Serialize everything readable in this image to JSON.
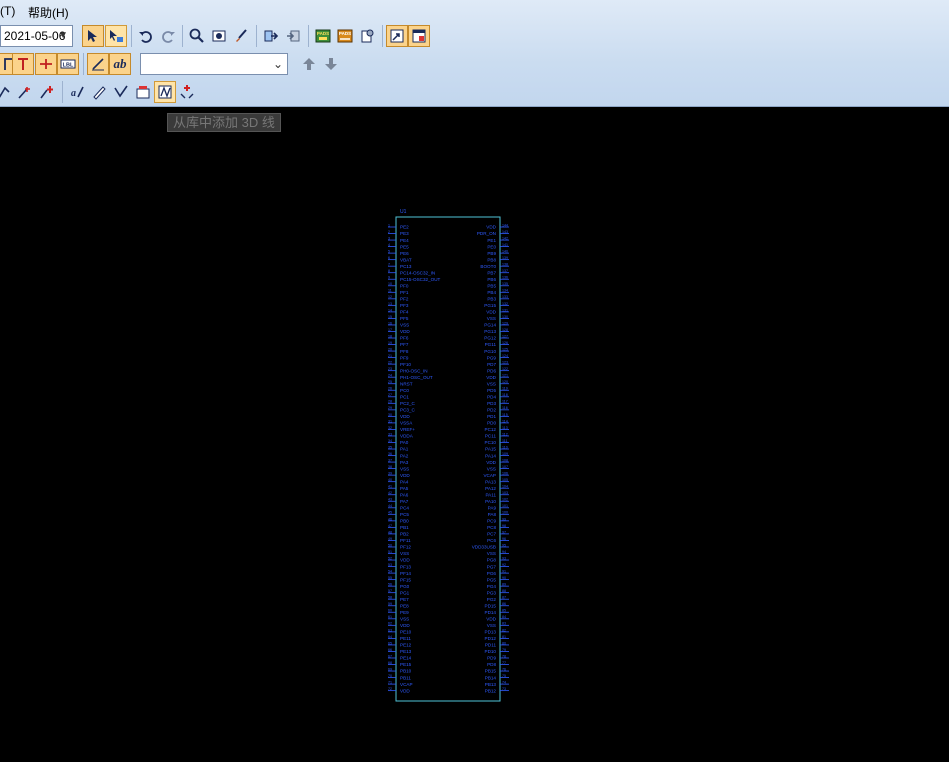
{
  "menu": {
    "partial_label": "(T)",
    "help_label": "帮助(H)"
  },
  "toolbar": {
    "date_value": "2021-05-06",
    "empty_combo_value": "",
    "pads_label_1": "PADS",
    "pads_label_2": "PADS",
    "lbl_text": "LBL",
    "ab_text": "ab"
  },
  "tooltip": {
    "text": "从库中添加 3D 线"
  },
  "schematic": {
    "ref": "U1",
    "colors": {
      "body": "#4fc3d8",
      "text": "#2f5bff",
      "pin": "#2f5bff"
    },
    "left_pins": [
      "PE2",
      "PE3",
      "PE4",
      "PE5",
      "PE6",
      "VBAT",
      "PC13",
      "PC14-OSC32_IN",
      "PC15-OSC32_OUT",
      "PF0",
      "PF1",
      "PF2",
      "PF3",
      "PF4",
      "PF5",
      "VSS",
      "VDD",
      "PF6",
      "PF7",
      "PF8",
      "PF9",
      "PF10",
      "PH0-OSC_IN",
      "PH1-OSC_OUT",
      "NRST",
      "PC0",
      "PC1",
      "PC2_C",
      "PC3_C",
      "VDD",
      "VSSA",
      "VREF+",
      "VDDA",
      "PA0",
      "PA1",
      "PA2",
      "PA3",
      "VSS",
      "VDD",
      "PA4",
      "PA5",
      "PA6",
      "PA7",
      "PC4",
      "PC5",
      "PB0",
      "PB1",
      "PB2",
      "PF11",
      "PF12",
      "VSS",
      "VDD",
      "PF13",
      "PF14",
      "PF15",
      "PG0",
      "PG1",
      "PE7",
      "PE8",
      "PE9",
      "VSS",
      "VDD",
      "PE10",
      "PE11",
      "PE12",
      "PE13",
      "PE14",
      "PE15",
      "PB10",
      "PB11",
      "VCAP",
      "VDD"
    ],
    "right_pins": [
      "VDD",
      "PDR_ON",
      "PE1",
      "PE0",
      "PB9",
      "PB8",
      "BOOT0",
      "PB7",
      "PB6",
      "PB5",
      "PB4",
      "PB3",
      "PG15",
      "VDD",
      "VSS",
      "PG14",
      "PG13",
      "PG12",
      "PG11",
      "PG10",
      "PG9",
      "PD7",
      "PD6",
      "VDD",
      "VSS",
      "PD5",
      "PD4",
      "PD3",
      "PD2",
      "PD1",
      "PD0",
      "PC12",
      "PC11",
      "PC10",
      "PA15",
      "PA14",
      "VDD",
      "VSS",
      "VCAP",
      "PA13",
      "PA12",
      "PA11",
      "PA10",
      "PA9",
      "PA8",
      "PC9",
      "PC8",
      "PC7",
      "PC6",
      "VDD33USB",
      "VSS",
      "PG8",
      "PG7",
      "PG6",
      "PG5",
      "PG4",
      "PG3",
      "PG2",
      "PD15",
      "PD14",
      "VDD",
      "VSS",
      "PD13",
      "PD12",
      "PD11",
      "PD10",
      "PD9",
      "PD8",
      "PB15",
      "PB14",
      "PB13",
      "PB12"
    ],
    "left_numbers": [
      "1",
      "2",
      "3",
      "4",
      "5",
      "6",
      "7",
      "8",
      "9",
      "10",
      "11",
      "12",
      "13",
      "14",
      "15",
      "16",
      "17",
      "18",
      "19",
      "20",
      "21",
      "22",
      "23",
      "24",
      "25",
      "26",
      "27",
      "28",
      "29",
      "30",
      "31",
      "32",
      "33",
      "34",
      "35",
      "36",
      "37",
      "38",
      "39",
      "40",
      "41",
      "42",
      "43",
      "44",
      "45",
      "46",
      "47",
      "48",
      "49",
      "50",
      "51",
      "52",
      "53",
      "54",
      "55",
      "56",
      "57",
      "58",
      "59",
      "60",
      "61",
      "62",
      "63",
      "64",
      "65",
      "66",
      "67",
      "68",
      "69",
      "70",
      "71",
      "72"
    ],
    "right_numbers": [
      "144",
      "143",
      "142",
      "141",
      "140",
      "139",
      "138",
      "137",
      "136",
      "135",
      "134",
      "133",
      "132",
      "131",
      "130",
      "129",
      "128",
      "127",
      "126",
      "125",
      "124",
      "123",
      "122",
      "121",
      "120",
      "119",
      "118",
      "117",
      "116",
      "115",
      "114",
      "113",
      "112",
      "111",
      "110",
      "109",
      "108",
      "107",
      "106",
      "105",
      "104",
      "103",
      "102",
      "101",
      "100",
      "99",
      "98",
      "97",
      "96",
      "95",
      "94",
      "93",
      "92",
      "91",
      "90",
      "89",
      "88",
      "87",
      "86",
      "85",
      "84",
      "83",
      "82",
      "81",
      "80",
      "79",
      "78",
      "77",
      "76",
      "75",
      "74",
      "73"
    ]
  }
}
